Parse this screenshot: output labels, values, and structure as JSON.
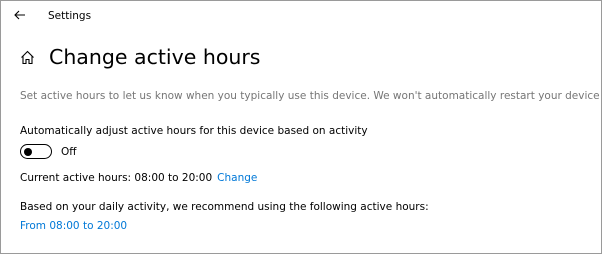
{
  "window": {
    "title": "Settings"
  },
  "page": {
    "title": "Change active hours",
    "description": "Set active hours to let us know when you typically use this device. We won't automatically restart your device during this time."
  },
  "auto_adjust": {
    "label": "Automatically adjust active hours for this device based on activity",
    "toggle_state": "Off",
    "is_on": false
  },
  "current_hours": {
    "label": "Current active hours: 08:00 to 20:00",
    "change_link": "Change"
  },
  "recommendation": {
    "label": "Based on your daily activity, we recommend using the following active hours:",
    "link": "From 08:00 to 20:00"
  },
  "colors": {
    "link": "#0078d7",
    "secondary_text": "#767676",
    "text": "#000000",
    "background": "#ffffff"
  },
  "icons": {
    "back": "back-arrow-icon",
    "home": "home-icon"
  }
}
